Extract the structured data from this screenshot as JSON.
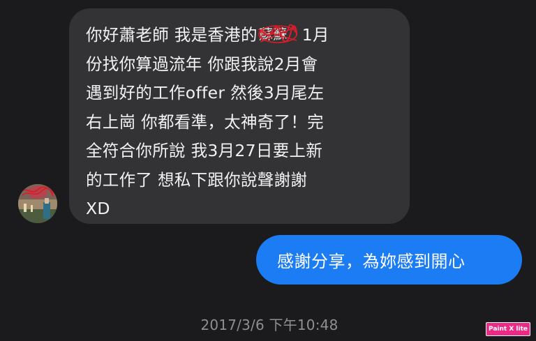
{
  "incoming_message": {
    "line1_before_redaction": "你好蕭老師 我是香港的",
    "redacted_text": "蘇蘇",
    "line1_after_redaction": "1月",
    "lines": [
      "份找你算過流年 你跟我說2月會",
      "遇到好的工作offer 然後3月尾左",
      "右上崗 你都看準，太神奇了！完",
      "全符合你所說 我3月27日要上新",
      "的工作了 想私下跟你說聲謝謝",
      "XD"
    ]
  },
  "outgoing_message": {
    "text": "感謝分享，為妳感到開心"
  },
  "timestamp": "2017/3/6 下午10:48",
  "watermark": "Paint X lite",
  "colors": {
    "background": "#1b1b1d",
    "incoming_bubble": "#333336",
    "outgoing_bubble": "#1c7cf4",
    "timestamp_text": "#8e8e93",
    "redaction_scribble": "#d81e2a",
    "watermark_bg": "#ea2a84"
  },
  "icons": {
    "avatar": "profile-photo"
  }
}
